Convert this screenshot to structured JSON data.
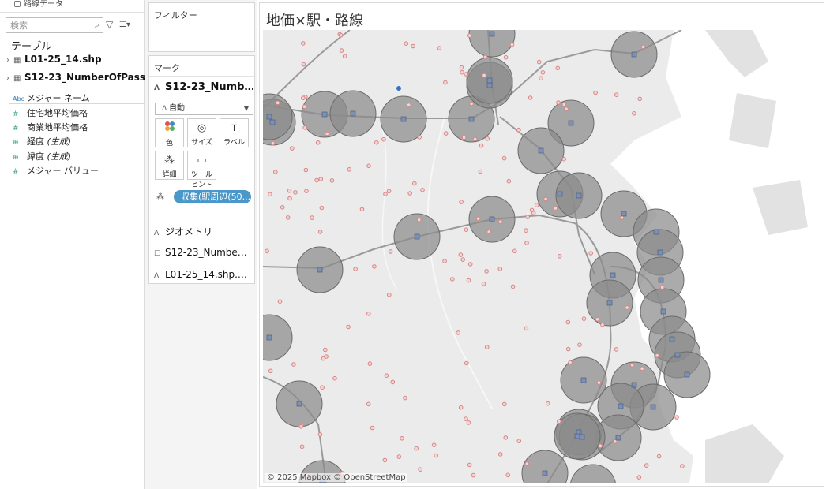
{
  "data_pane": {
    "datasource_partial": "路線データ",
    "search_placeholder": "検索",
    "tables_header": "テーブル",
    "tables": [
      {
        "label": "L01-25_14.shp"
      },
      {
        "label": "S12-23_NumberOfPass…"
      }
    ],
    "fields": [
      {
        "type": "Abc",
        "label": "メジャー ネーム",
        "italic_suffix": ""
      },
      {
        "type": "#",
        "label": "住宅地平均価格",
        "italic_suffix": ""
      },
      {
        "type": "#",
        "label": "商業地平均価格",
        "italic_suffix": ""
      },
      {
        "type": "globe",
        "label": "経度 ",
        "italic_suffix": "(生成)"
      },
      {
        "type": "globe",
        "label": "緯度 ",
        "italic_suffix": "(生成)"
      },
      {
        "type": "#",
        "label": "メジャー バリュー",
        "italic_suffix": ""
      }
    ]
  },
  "filters_card": {
    "title": "フィルター"
  },
  "marks_card": {
    "title": "マーク",
    "active_layer": "S12-23_Numb…",
    "mark_type": "自動",
    "encodings": [
      {
        "icon": "color-icon",
        "label": "色"
      },
      {
        "icon": "size-icon",
        "label": "サイズ"
      },
      {
        "icon": "text-icon",
        "label": "ラベル"
      },
      {
        "icon": "detail-icon",
        "label": "詳細"
      },
      {
        "icon": "tooltip-icon",
        "label": "ツールヒント"
      }
    ],
    "detail_pill": "収集(駅周辺(50...",
    "layers": [
      {
        "label": "ジオメトリ"
      },
      {
        "label": "S12-23_Numbe…"
      },
      {
        "label": "L01-25_14.shp.…"
      }
    ]
  },
  "sheet": {
    "title": "地価×駅・路線",
    "attribution": "© 2025 Mapbox © OpenStreetMap"
  },
  "colors": {
    "pill": "#4a97c9",
    "station_buffer": "#8a8a8a",
    "land_price_point": "#d98484",
    "map_water": "#ffffff",
    "map_land": "#ececec"
  }
}
